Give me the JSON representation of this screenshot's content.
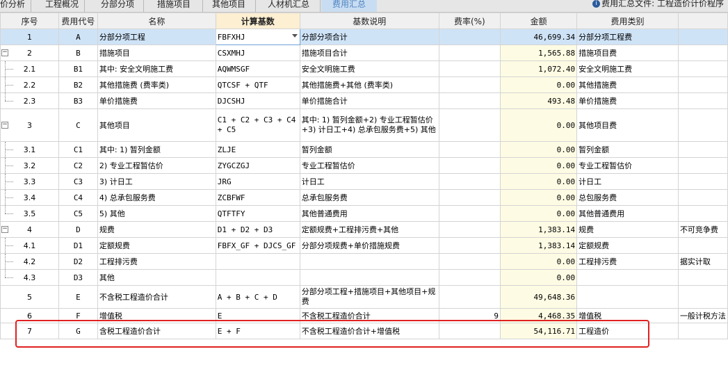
{
  "tabs": [
    "价分析",
    "工程概况",
    "分部分项",
    "措施项目",
    "其他项目",
    "人材机汇总",
    "费用汇总"
  ],
  "active_tab": "费用汇总",
  "file_info": {
    "icon": "info-icon",
    "text": "费用汇总文件: 工程造价计价程序"
  },
  "columns": [
    "序号",
    "费用代号",
    "名称",
    "计算基数",
    "基数说明",
    "费率(%)",
    "金额",
    "费用类别",
    ""
  ],
  "rows": [
    {
      "seq": "1",
      "code": "A",
      "name": "分部分项工程",
      "base": "FBFXHJ",
      "desc": "分部分项合计",
      "rate": "",
      "amount": "46,699.34",
      "category": "分部分项工程费",
      "note": ""
    },
    {
      "seq": "2",
      "code": "B",
      "name": "措施项目",
      "base": "CSXMHJ",
      "desc": "措施项目合计",
      "rate": "",
      "amount": "1,565.88",
      "category": "措施项目费",
      "note": ""
    },
    {
      "seq": "2.1",
      "code": "B1",
      "name": "其中: 安全文明施工费",
      "base": "AQWMSGF",
      "desc": "安全文明施工费",
      "rate": "",
      "amount": "1,072.40",
      "category": "安全文明施工费",
      "note": ""
    },
    {
      "seq": "2.2",
      "code": "B2",
      "name": "其他措施费 (费率类)",
      "base": "QTCSF + QTF",
      "desc": "其他措施费+其他 (费率类)",
      "rate": "",
      "amount": "0.00",
      "category": "其他措施费",
      "note": ""
    },
    {
      "seq": "2.3",
      "code": "B3",
      "name": "单价措施费",
      "base": "DJCSHJ",
      "desc": "单价措施合计",
      "rate": "",
      "amount": "493.48",
      "category": "单价措施费",
      "note": ""
    },
    {
      "seq": "3",
      "code": "C",
      "name": "其他项目",
      "base": "C1 + C2 + C3 + C4 + C5",
      "desc": "其中: 1) 暂列金额+2) 专业工程暂估价+3) 计日工+4) 总承包服务费+5) 其他",
      "rate": "",
      "amount": "0.00",
      "category": "其他项目费",
      "note": ""
    },
    {
      "seq": "3.1",
      "code": "C1",
      "name": "其中: 1) 暂列金额",
      "base": "ZLJE",
      "desc": "暂列金额",
      "rate": "",
      "amount": "0.00",
      "category": "暂列金额",
      "note": ""
    },
    {
      "seq": "3.2",
      "code": "C2",
      "name": "2) 专业工程暂估价",
      "base": "ZYGCZGJ",
      "desc": "专业工程暂估价",
      "rate": "",
      "amount": "0.00",
      "category": "专业工程暂估价",
      "note": ""
    },
    {
      "seq": "3.3",
      "code": "C3",
      "name": "3) 计日工",
      "base": "JRG",
      "desc": "计日工",
      "rate": "",
      "amount": "0.00",
      "category": "计日工",
      "note": ""
    },
    {
      "seq": "3.4",
      "code": "C4",
      "name": "4) 总承包服务费",
      "base": "ZCBFWF",
      "desc": "总承包服务费",
      "rate": "",
      "amount": "0.00",
      "category": "总包服务费",
      "note": ""
    },
    {
      "seq": "3.5",
      "code": "C5",
      "name": "5) 其他",
      "base": "QTFTFY",
      "desc": "其他普通费用",
      "rate": "",
      "amount": "0.00",
      "category": "其他普通费用",
      "note": ""
    },
    {
      "seq": "4",
      "code": "D",
      "name": "规费",
      "base": "D1 + D2 + D3",
      "desc": "定额规费+工程排污费+其他",
      "rate": "",
      "amount": "1,383.14",
      "category": "规费",
      "note": "不可竞争费"
    },
    {
      "seq": "4.1",
      "code": "D1",
      "name": "定额规费",
      "base": "FBFX_GF + DJCS_GF",
      "desc": "分部分项规费+单价措施规费",
      "rate": "",
      "amount": "1,383.14",
      "category": "定额规费",
      "note": ""
    },
    {
      "seq": "4.2",
      "code": "D2",
      "name": "工程排污费",
      "base": "",
      "desc": "",
      "rate": "",
      "amount": "0.00",
      "category": "工程排污费",
      "note": "据实计取"
    },
    {
      "seq": "4.3",
      "code": "D3",
      "name": "其他",
      "base": "",
      "desc": "",
      "rate": "",
      "amount": "0.00",
      "category": "",
      "note": ""
    },
    {
      "seq": "5",
      "code": "E",
      "name": "不含税工程造价合计",
      "base": "A + B + C + D",
      "desc": "分部分项工程+措施项目+其他项目+规费",
      "rate": "",
      "amount": "49,648.36",
      "category": "",
      "note": ""
    },
    {
      "seq": "6",
      "code": "F",
      "name": "增值税",
      "base": "E",
      "desc": "不含税工程造价合计",
      "rate": "9",
      "amount": "4,468.35",
      "category": "增值税",
      "note": "一般计税方法"
    },
    {
      "seq": "7",
      "code": "G",
      "name": "含税工程造价合计",
      "base": "E + F",
      "desc": "不含税工程造价合计+增值税",
      "rate": "",
      "amount": "54,116.71",
      "category": "工程造价",
      "note": ""
    }
  ]
}
